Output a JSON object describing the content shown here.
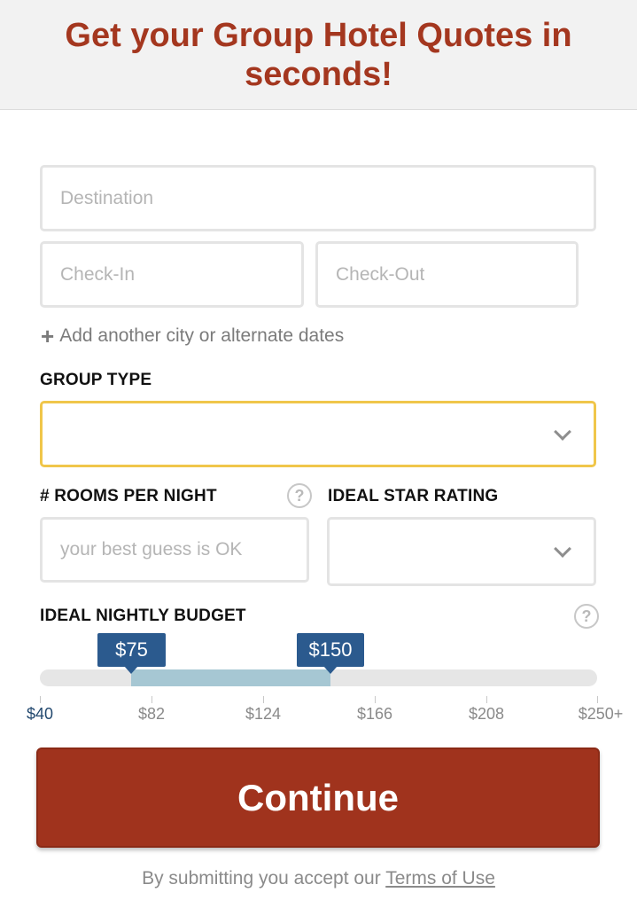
{
  "header": {
    "title": "Get your Group Hotel Quotes in seconds!"
  },
  "form": {
    "destination_placeholder": "Destination",
    "checkin_placeholder": "Check-In",
    "checkout_placeholder": "Check-Out",
    "add_city_icon": "+",
    "add_city_label": "Add another city or alternate dates",
    "group_type_label": "GROUP TYPE",
    "group_type_value": "",
    "rooms_label": "# ROOMS PER NIGHT",
    "rooms_placeholder": "your best guess is OK",
    "star_rating_label": "IDEAL STAR RATING",
    "star_rating_value": "",
    "help_icon": "?",
    "budget_label": "IDEAL NIGHTLY BUDGET"
  },
  "budget_slider": {
    "min_handle": "$75",
    "max_handle": "$150",
    "min_value": 75,
    "max_value": 150,
    "ticks": [
      "$40",
      "$82",
      "$124",
      "$166",
      "$208",
      "$250+"
    ]
  },
  "actions": {
    "continue_label": "Continue"
  },
  "footer": {
    "terms_prefix": "By submitting you accept our",
    "terms_link": "Terms of Use"
  },
  "colors": {
    "brand": "#a4371f",
    "button": "#a0331d",
    "handle": "#2b5a8e",
    "range": "#a6c7d3",
    "focus": "#f0c64a"
  }
}
